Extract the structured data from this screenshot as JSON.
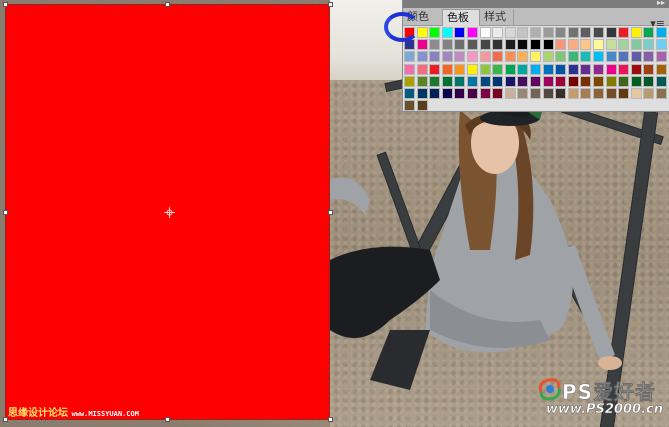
{
  "swatches_panel": {
    "tabs": [
      {
        "label": "颜色",
        "active": false
      },
      {
        "label": "色板",
        "active": true
      },
      {
        "label": "样式",
        "active": false
      }
    ],
    "collapse_glyph": "▸▸",
    "menu_glyph": "▾≡",
    "rows": [
      [
        "#ff0000",
        "#ffff00",
        "#00ff00",
        "#00ffff",
        "#0000ff",
        "#ff00ff",
        "#ffffff",
        "#ebebeb",
        "#d7d7d7",
        "#c3c3c3",
        "#afafaf",
        "#9b9b9b",
        "#878787",
        "#737373",
        "#5f5f5f",
        "#4b4b4b",
        "#373737",
        "#ed1c24",
        "#fff200",
        "#00a651",
        "#00aeef"
      ],
      [
        "#2e3192",
        "#ec008c",
        "#8c8c8c",
        "#828282",
        "#6e6e6e",
        "#5a5a5a",
        "#464646",
        "#323232",
        "#1e1e1e",
        "#0a0a0a",
        "#000000",
        "#000000",
        "#f7977a",
        "#f9ad81",
        "#fdc68a",
        "#fff79a",
        "#c4df9b",
        "#a2d39c",
        "#82ca9d",
        "#7bcdc8",
        "#6ecff6"
      ],
      [
        "#7ea7d8",
        "#8493ca",
        "#8882be",
        "#a187be",
        "#bc8dbf",
        "#f49ac2",
        "#f6989d",
        "#f26c4f",
        "#f68e55",
        "#fbaf5c",
        "#fff467",
        "#acd372",
        "#7cc576",
        "#3bb878",
        "#1abbb4",
        "#00bff3",
        "#438ccb",
        "#5574b9",
        "#605ca8",
        "#855fa8",
        "#a763a8"
      ],
      [
        "#f06ea9",
        "#f26d7d",
        "#ed1c24",
        "#f26522",
        "#f7941d",
        "#fff200",
        "#8dc63f",
        "#39b54a",
        "#00a651",
        "#00a99d",
        "#00aeef",
        "#0072bc",
        "#0054a6",
        "#2e3192",
        "#662d91",
        "#92278f",
        "#ec008c",
        "#ed145b",
        "#9e0b0f",
        "#a0410d",
        "#a36209"
      ],
      [
        "#aba000",
        "#598527",
        "#1a7b30",
        "#007236",
        "#00746b",
        "#0076a3",
        "#004a80",
        "#003471",
        "#1b1464",
        "#440e62",
        "#630460",
        "#9e005d",
        "#9e0039",
        "#790000",
        "#7b2e00",
        "#7d4900",
        "#827b00",
        "#406618",
        "#005e20",
        "#005826",
        "#005952"
      ],
      [
        "#005b7f",
        "#003663",
        "#002157",
        "#0d004c",
        "#32004b",
        "#4b0049",
        "#7b0046",
        "#7a0026",
        "#c7b299",
        "#998675",
        "#736357",
        "#534741",
        "#37302a",
        "#c69c6d",
        "#a67c52",
        "#8c6239",
        "#754c24",
        "#603913",
        "#e5c7a0",
        "#b69a71",
        "#8a7250"
      ],
      [
        "#6b4f2a",
        "#5a3d1c"
      ]
    ]
  },
  "canvas": {
    "fill_color": "#ff0000",
    "watermark_left": {
      "cn": "思缘设计论坛",
      "url": "www.MISSYUAN.COM"
    },
    "watermark_right": {
      "cn": "PS爱好者",
      "url": "www.PS2000.cn"
    }
  }
}
